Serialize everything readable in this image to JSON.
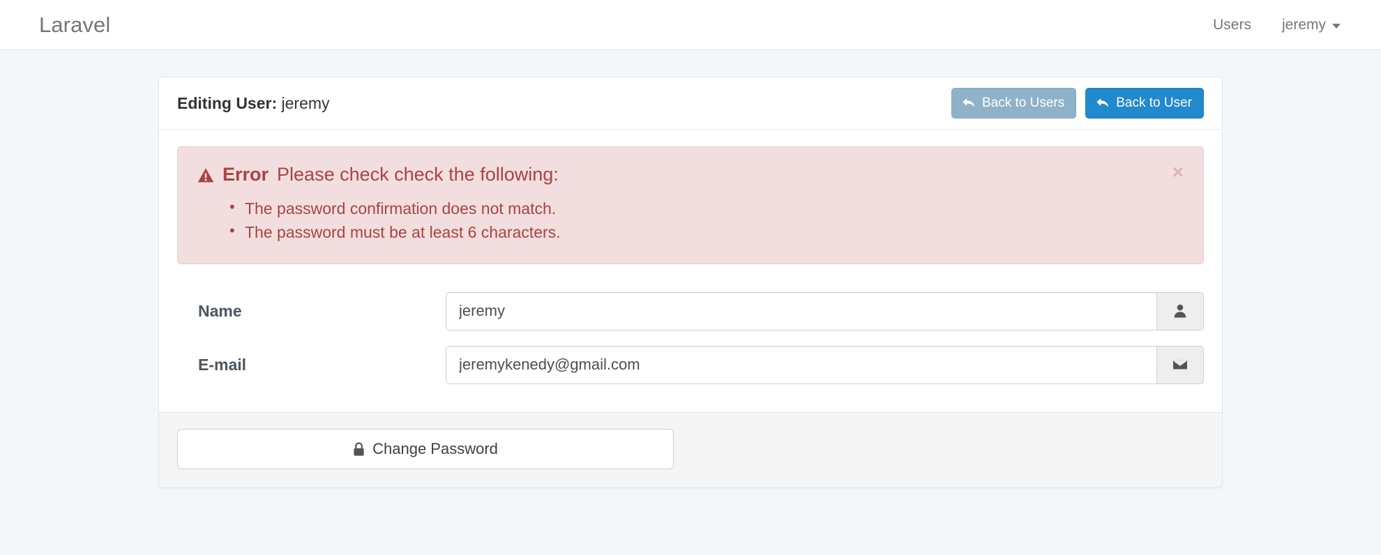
{
  "navbar": {
    "brand": "Laravel",
    "links": [
      {
        "label": "Users",
        "name": "nav-link-users"
      },
      {
        "label": "jeremy",
        "name": "nav-dropdown-user"
      }
    ],
    "brand_color": "#777777"
  },
  "panel": {
    "title_strong": "Editing User:",
    "title_value": "jeremy",
    "actions": {
      "back_to_users": {
        "label": "Back to Users",
        "icon": "reply-arrow-icon",
        "color": "#8fb2c9"
      },
      "back_to_user": {
        "label": "Back to User",
        "icon": "reply-arrow-icon",
        "color": "#2189cc"
      }
    }
  },
  "alert": {
    "icon": "warning-triangle-icon",
    "strong": "Error",
    "message": "Please check check the following:",
    "close_label": "×",
    "items": [
      "The password confirmation does not match.",
      "The password must be at least 6 characters."
    ],
    "bg_color": "#f2dede",
    "border_color": "#ebcccc",
    "text_color": "#a94442"
  },
  "form": {
    "fields": [
      {
        "label": "Name",
        "value": "jeremy",
        "placeholder": "Name",
        "addon_icon": "user-icon",
        "name": "name-field"
      },
      {
        "label": "E-mail",
        "value": "jeremykenedy@gmail.com",
        "placeholder": "E-mail",
        "addon_icon": "envelope-icon",
        "name": "email-field"
      }
    ]
  },
  "footer": {
    "change_password": {
      "label": "Change Password",
      "icon": "lock-icon"
    }
  }
}
